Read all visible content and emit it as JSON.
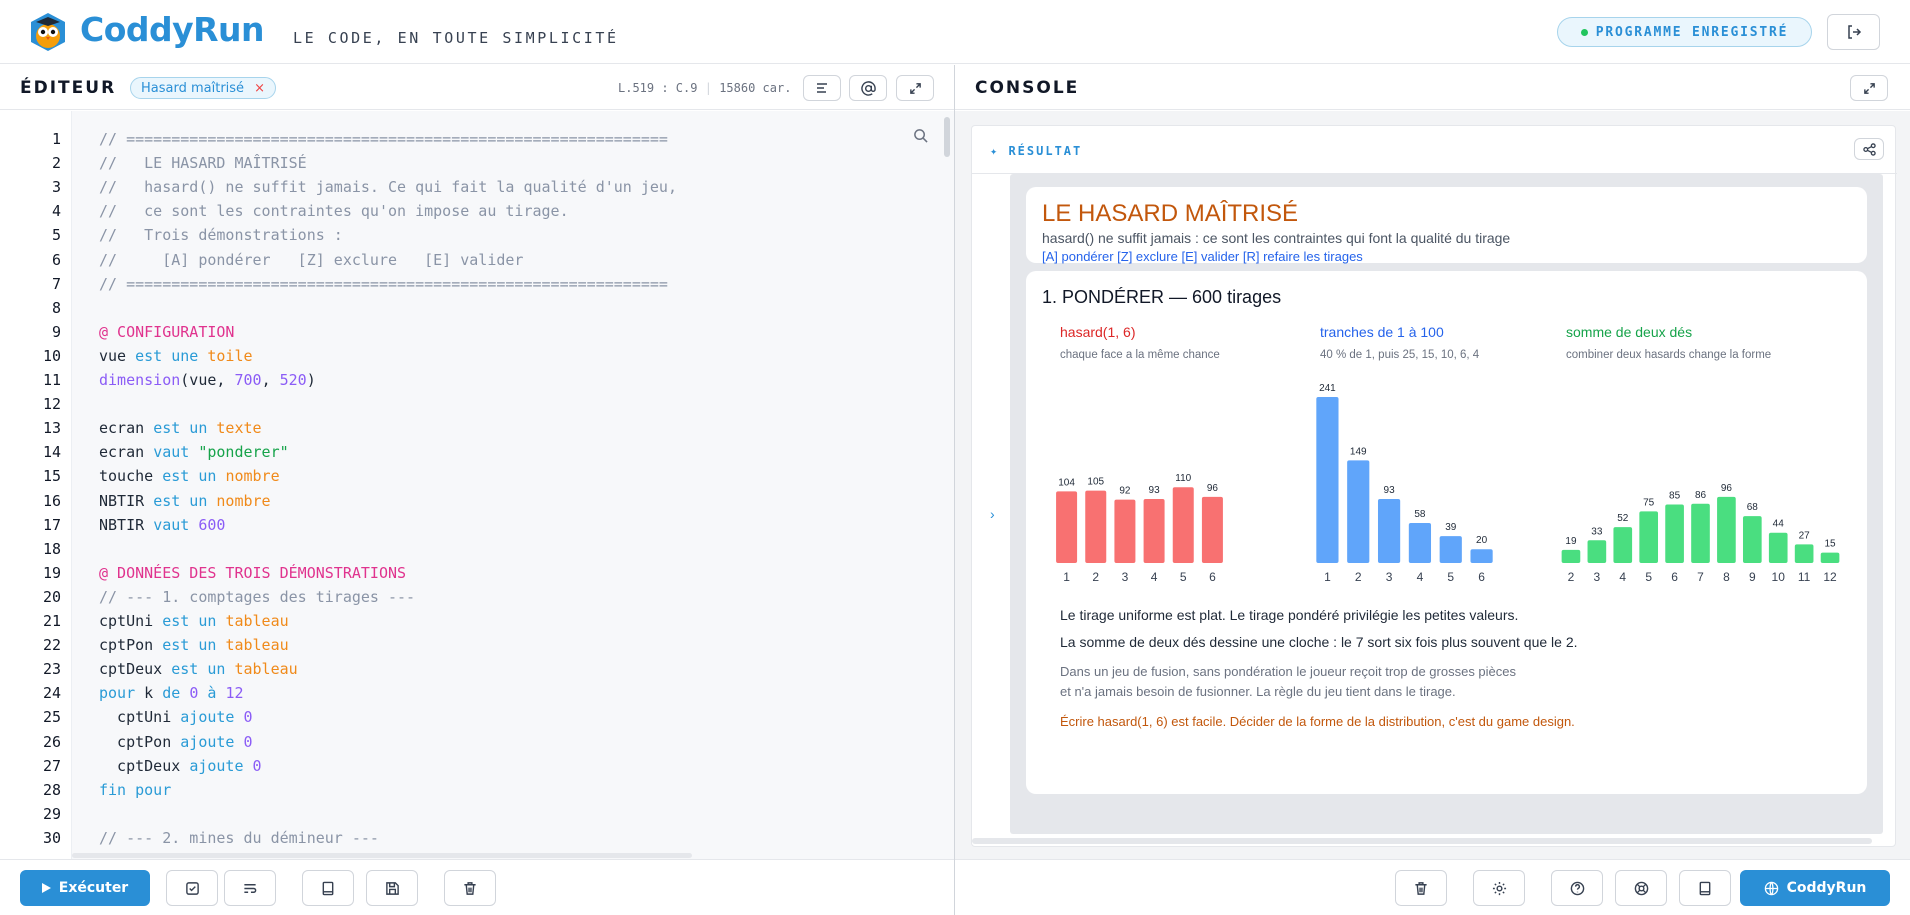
{
  "header": {
    "brand": "CoddyRun",
    "tagline": "LE CODE, EN TOUTE SIMPLICITÉ",
    "status": "PROGRAMME ENREGISTRÉ",
    "logout_icon": "logout-icon"
  },
  "editor": {
    "title": "ÉDITEUR",
    "file_chip": "Hasard maîtrisé",
    "chip_close": "×",
    "cursor": "L.519 : C.9",
    "chars": "15860 car.",
    "line_numbers": [
      "1",
      "2",
      "3",
      "4",
      "5",
      "6",
      "7",
      "8",
      "9",
      "10",
      "11",
      "12",
      "13",
      "14",
      "15",
      "16",
      "17",
      "18",
      "19",
      "20",
      "21",
      "22",
      "23",
      "24",
      "25",
      "26",
      "27",
      "28",
      "29",
      "30"
    ],
    "lines": [
      [
        [
          "c",
          "// ============================================================"
        ]
      ],
      [
        [
          "c",
          "//   LE HASARD MAÎTRISÉ"
        ]
      ],
      [
        [
          "c",
          "//   hasard() ne suffit jamais. Ce qui fait la qualité d'un jeu,"
        ]
      ],
      [
        [
          "c",
          "//   ce sont les contraintes qu'on impose au tirage."
        ]
      ],
      [
        [
          "c",
          "//   Trois démonstrations :"
        ]
      ],
      [
        [
          "c",
          "//     [A] pondérer   [Z] exclure   [E] valider"
        ]
      ],
      [
        [
          "c",
          "// ============================================================"
        ]
      ],
      [],
      [
        [
          "a",
          "@ CONFIGURATION"
        ]
      ],
      [
        [
          "p",
          "vue "
        ],
        [
          "k",
          "est une "
        ],
        [
          "t",
          "toile"
        ]
      ],
      [
        [
          "f",
          "dimension"
        ],
        [
          "p",
          "(vue, "
        ],
        [
          "n",
          "700"
        ],
        [
          "p",
          ", "
        ],
        [
          "n",
          "520"
        ],
        [
          "p",
          ")"
        ]
      ],
      [],
      [
        [
          "p",
          "ecran "
        ],
        [
          "k",
          "est un "
        ],
        [
          "t",
          "texte"
        ]
      ],
      [
        [
          "p",
          "ecran "
        ],
        [
          "k",
          "vaut "
        ],
        [
          "s",
          "\"ponderer\""
        ]
      ],
      [
        [
          "p",
          "touche "
        ],
        [
          "k",
          "est un "
        ],
        [
          "t",
          "nombre"
        ]
      ],
      [
        [
          "p",
          "NBTIR "
        ],
        [
          "k",
          "est un "
        ],
        [
          "t",
          "nombre"
        ]
      ],
      [
        [
          "p",
          "NBTIR "
        ],
        [
          "k",
          "vaut "
        ],
        [
          "n",
          "600"
        ]
      ],
      [],
      [
        [
          "a",
          "@ DONNÉES DES TROIS DÉMONSTRATIONS"
        ]
      ],
      [
        [
          "c",
          "// --- 1. comptages des tirages ---"
        ]
      ],
      [
        [
          "p",
          "cptUni "
        ],
        [
          "k",
          "est un "
        ],
        [
          "t",
          "tableau"
        ]
      ],
      [
        [
          "p",
          "cptPon "
        ],
        [
          "k",
          "est un "
        ],
        [
          "t",
          "tableau"
        ]
      ],
      [
        [
          "p",
          "cptDeux "
        ],
        [
          "k",
          "est un "
        ],
        [
          "t",
          "tableau"
        ]
      ],
      [
        [
          "k",
          "pour "
        ],
        [
          "p",
          "k "
        ],
        [
          "k",
          "de "
        ],
        [
          "n",
          "0 "
        ],
        [
          "k",
          "à "
        ],
        [
          "n",
          "12"
        ]
      ],
      [
        [
          "p",
          "  cptUni "
        ],
        [
          "k",
          "ajoute "
        ],
        [
          "n",
          "0"
        ]
      ],
      [
        [
          "p",
          "  cptPon "
        ],
        [
          "k",
          "ajoute "
        ],
        [
          "n",
          "0"
        ]
      ],
      [
        [
          "p",
          "  cptDeux "
        ],
        [
          "k",
          "ajoute "
        ],
        [
          "n",
          "0"
        ]
      ],
      [
        [
          "k",
          "fin pour"
        ]
      ],
      [],
      [
        [
          "c",
          "// --- 2. mines du démineur ---"
        ]
      ]
    ],
    "run_label": "Exécuter"
  },
  "console": {
    "title": "CONSOLE",
    "result_label": "✦ RÉSULTAT",
    "app": {
      "title": "LE HASARD MAÎTRISÉ",
      "subtitle": "hasard() ne suffit jamais : ce sont les contraintes qui font la qualité du tirage",
      "keys": "[A] pondérer [Z] exclure [E] valider [R] refaire les tirages",
      "section": "1. PONDÉRER — 600 tirages",
      "text1": "Le tirage uniforme est plat. Le tirage pondéré privilégie les petites valeurs.",
      "text2": "La somme de deux dés dessine une cloche : le 7 sort six fois plus souvent que le 2.",
      "text3": "Dans un jeu de fusion, sans pondération le joueur reçoit trop de grosses pièces",
      "text4": "et n'a jamais besoin de fusionner. La règle du jeu tient dans le tirage.",
      "text5": "Écrire hasard(1, 6) est facile. Décider de la forme de la distribution, c'est du game design."
    },
    "run_label": "CoddyRun"
  },
  "chart_data": [
    {
      "type": "bar",
      "title": "hasard(1, 6)",
      "subtitle": "chaque face a la même chance",
      "categories": [
        "1",
        "2",
        "3",
        "4",
        "5",
        "6"
      ],
      "values": [
        104,
        105,
        92,
        93,
        110,
        96
      ],
      "color": "#f87171",
      "title_color": "#dc2626"
    },
    {
      "type": "bar",
      "title": "tranches de 1 à 100",
      "subtitle": "40 % de 1, puis 25, 15, 10, 6, 4",
      "categories": [
        "1",
        "2",
        "3",
        "4",
        "5",
        "6"
      ],
      "values": [
        241,
        149,
        93,
        58,
        39,
        20
      ],
      "color": "#60a5fa",
      "title_color": "#2563eb"
    },
    {
      "type": "bar",
      "title": "somme de deux dés",
      "subtitle": "combiner deux hasards change la forme",
      "categories": [
        "2",
        "3",
        "4",
        "5",
        "6",
        "7",
        "8",
        "9",
        "10",
        "11",
        "12"
      ],
      "values": [
        19,
        33,
        52,
        75,
        85,
        86,
        96,
        68,
        44,
        27,
        15
      ],
      "color": "#4ade80",
      "title_color": "#16a34a"
    }
  ]
}
